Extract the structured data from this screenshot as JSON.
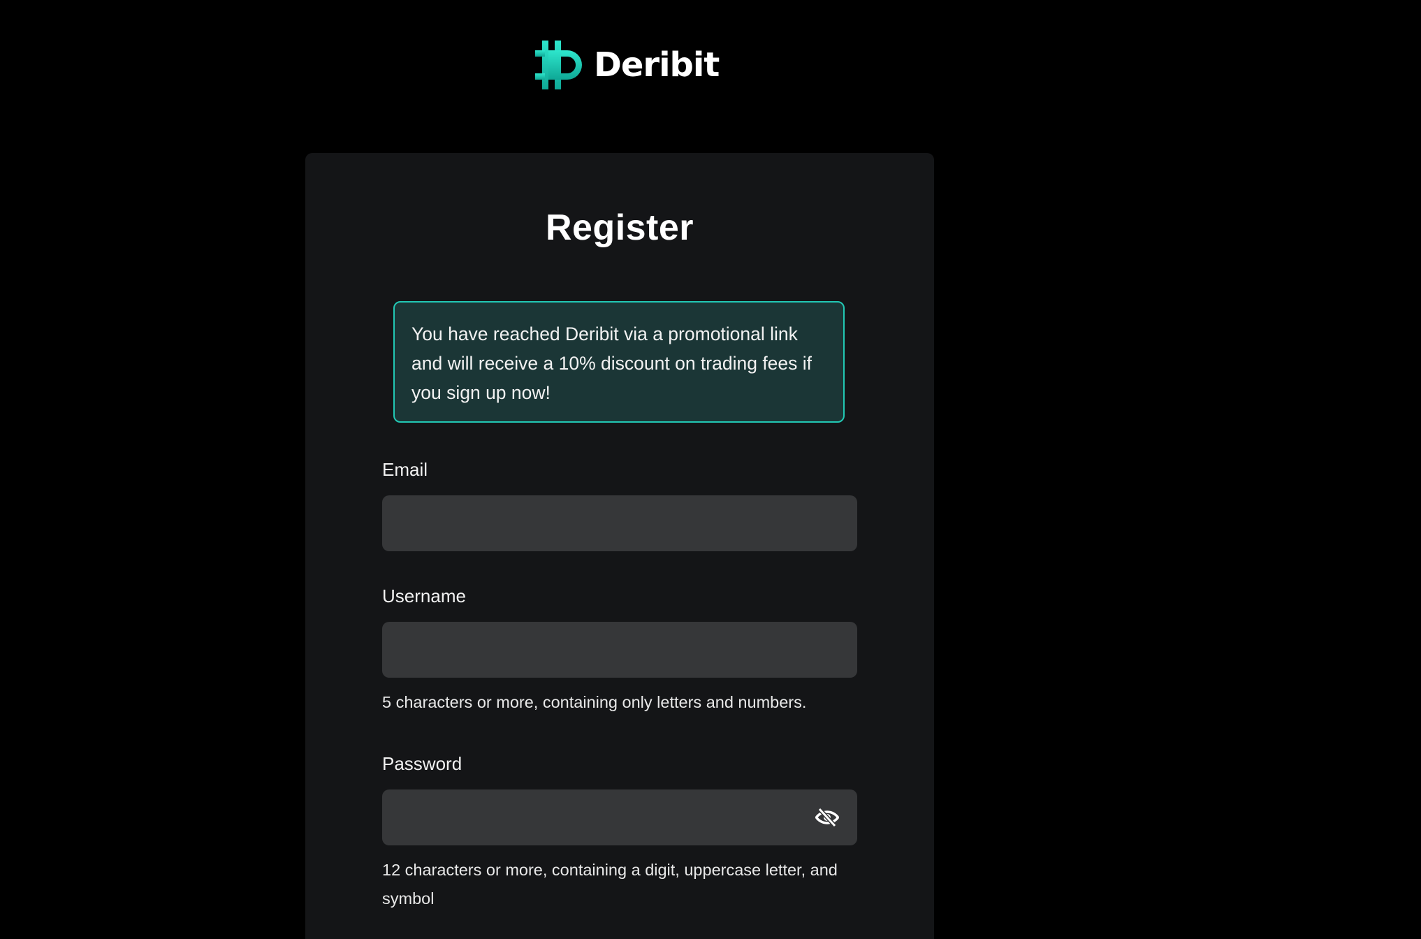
{
  "brand": {
    "name": "Deribit",
    "accent_color": "#22c8b4"
  },
  "register": {
    "title": "Register",
    "promo_message": "You have reached Deribit via a promotional link and will receive a 10% discount on trading fees if you sign up now!",
    "fields": {
      "email": {
        "label": "Email",
        "value": ""
      },
      "username": {
        "label": "Username",
        "value": "",
        "hint": "5 characters or more, containing only letters and numbers."
      },
      "password": {
        "label": "Password",
        "value": "",
        "hint": "12 characters or more, containing a digit, uppercase letter, and symbol",
        "toggle_icon": "eye-slash-icon"
      }
    }
  }
}
